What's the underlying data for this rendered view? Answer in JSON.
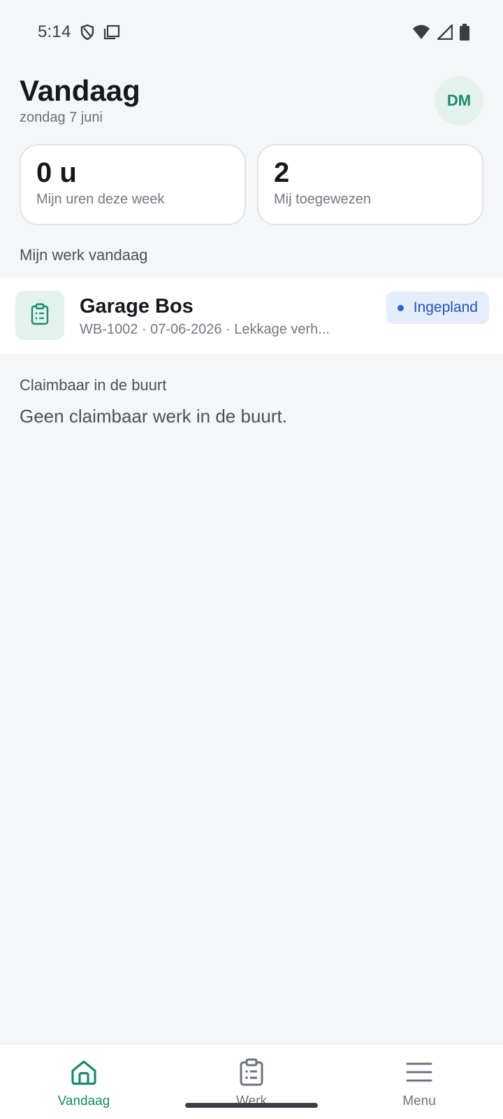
{
  "status_bar": {
    "time": "5:14",
    "icons_left": [
      "shield-icon",
      "screen-icon"
    ],
    "icons_right": [
      "wifi-icon",
      "signal-icon",
      "battery-icon"
    ]
  },
  "header": {
    "title": "Vandaag",
    "subtitle": "zondag 7 juni",
    "avatar_initials": "DM"
  },
  "stats": [
    {
      "value": "0 u",
      "label": "Mijn uren deze week"
    },
    {
      "value": "2",
      "label": "Mij toegewezen"
    }
  ],
  "sections": {
    "my_work_title": "Mijn werk vandaag",
    "nearby_title": "Claimbaar in de buurt",
    "nearby_empty": "Geen claimbaar werk in de buurt."
  },
  "work_items": [
    {
      "title": "Garage Bos",
      "meta": "WB-1002 · 07-06-2026 · Lekkage verh...",
      "status": "Ingepland",
      "icon": "clipboard-icon"
    }
  ],
  "bottom_nav": [
    {
      "label": "Vandaag",
      "icon": "home-icon",
      "active": true
    },
    {
      "label": "Werk",
      "icon": "clipboard-icon",
      "active": false
    },
    {
      "label": "Menu",
      "icon": "menu-icon",
      "active": false
    }
  ],
  "colors": {
    "accent": "#1a8a6a",
    "badge_bg": "#e4edfb",
    "badge_text": "#2553b8",
    "background": "#f5f6f8"
  }
}
